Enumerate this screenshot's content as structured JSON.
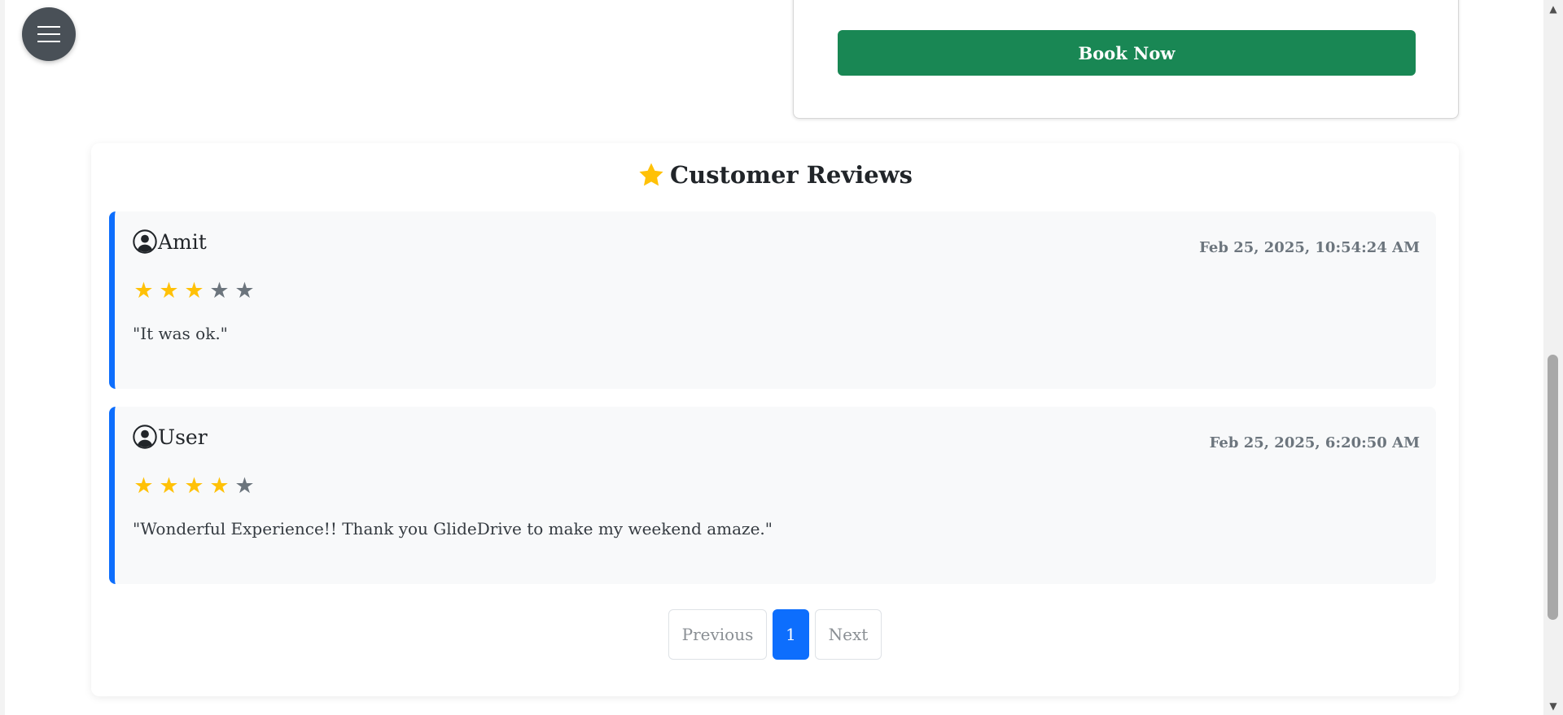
{
  "menu": {
    "icon": "hamburger-icon"
  },
  "booking": {
    "book_now_label": "Book Now",
    "button_color": "#198754"
  },
  "reviews": {
    "heading_icon": "star-icon",
    "title": "Customer Reviews",
    "accent_color": "#0d6efd",
    "items": [
      {
        "reviewer": "Amit",
        "date": "Feb 25, 2025, 10:54:24 AM",
        "rating": 3,
        "max_rating": 5,
        "comment": "\"It was ok.\""
      },
      {
        "reviewer": "User",
        "date": "Feb 25, 2025, 6:20:50 AM",
        "rating": 4,
        "max_rating": 5,
        "comment": "\"Wonderful Experience!! Thank you GlideDrive to make my weekend amaze.\""
      }
    ]
  },
  "pagination": {
    "previous_label": "Previous",
    "current_page": "1",
    "next_label": "Next"
  },
  "colors": {
    "star_filled": "#ffc107",
    "star_empty": "#6c757d"
  }
}
